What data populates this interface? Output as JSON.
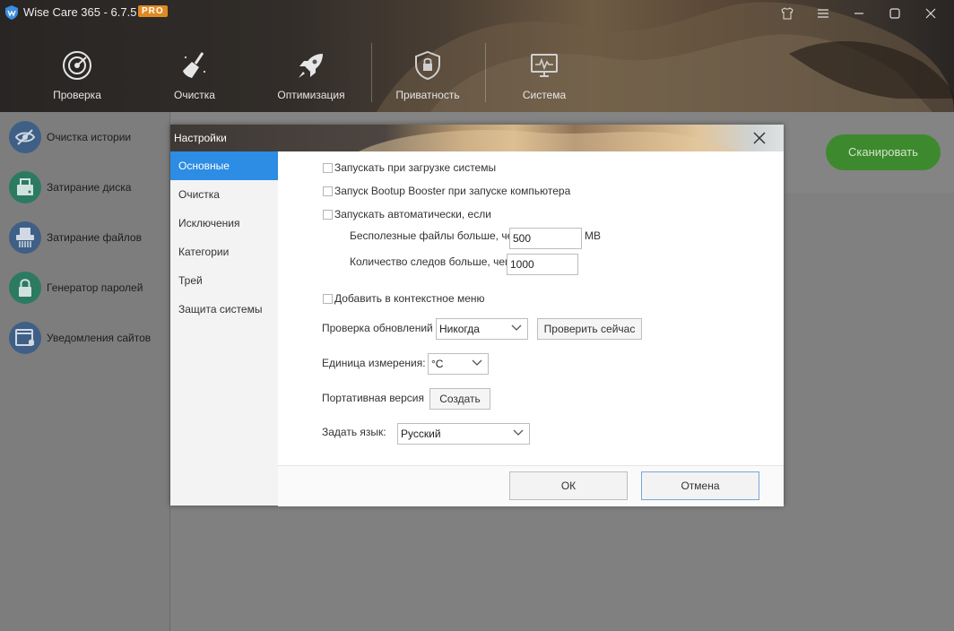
{
  "app": {
    "title": "Wise Care 365 - 6.7.5",
    "badge": "PRO",
    "window_buttons": [
      "shirt-icon",
      "menu-icon",
      "minimize-icon",
      "maximize-icon",
      "close-icon"
    ]
  },
  "nav": [
    {
      "label": "Проверка",
      "icon": "radar-icon"
    },
    {
      "label": "Очистка",
      "icon": "broom-icon"
    },
    {
      "label": "Оптимизация",
      "icon": "rocket-icon"
    },
    {
      "label": "Приватность",
      "icon": "shield-lock-icon"
    },
    {
      "label": "Система",
      "icon": "monitor-icon"
    }
  ],
  "sidebar": {
    "items": [
      {
        "label": "Очистка истории",
        "icon": "eye-slash-icon",
        "color": "#4a6fa5"
      },
      {
        "label": "Затирание диска",
        "icon": "disk-eraser-icon",
        "color": "#2e8a6e"
      },
      {
        "label": "Затирание файлов",
        "icon": "file-shredder-icon",
        "color": "#4a6fa5"
      },
      {
        "label": "Генератор паролей",
        "icon": "lock-icon",
        "color": "#2e8a6e"
      },
      {
        "label": "Уведомления сайтов",
        "icon": "browser-bell-icon",
        "color": "#4a6fa5"
      }
    ]
  },
  "scan_button": "Сканировать",
  "dialog": {
    "title": "Настройки",
    "menu": [
      "Основные",
      "Очистка",
      "Исключения",
      "Категории",
      "Трей",
      "Защита системы"
    ],
    "active_menu": "Основные",
    "options": {
      "startup": "Запускать при загрузке системы",
      "bootup_booster": "Запуск Bootup Booster при запуске компьютера",
      "auto_run": "Запускать автоматически, если",
      "junk_label": "Бесполезные файлы больше, чем",
      "junk_value": "500",
      "junk_unit": "MB",
      "traces_label": "Количество следов больше, чем",
      "traces_value": "1000",
      "context_menu": "Добавить в контекстное меню",
      "updates_label": "Проверка обновлений",
      "updates_value": "Никогда",
      "check_now": "Проверить сейчас",
      "unit_label": "Единица измерения:",
      "unit_value": "°C",
      "portable_label": "Портативная версия",
      "create": "Создать",
      "language_label": "Задать язык:",
      "language_value": "Русский"
    },
    "ok": "ОК",
    "cancel": "Отмена"
  }
}
